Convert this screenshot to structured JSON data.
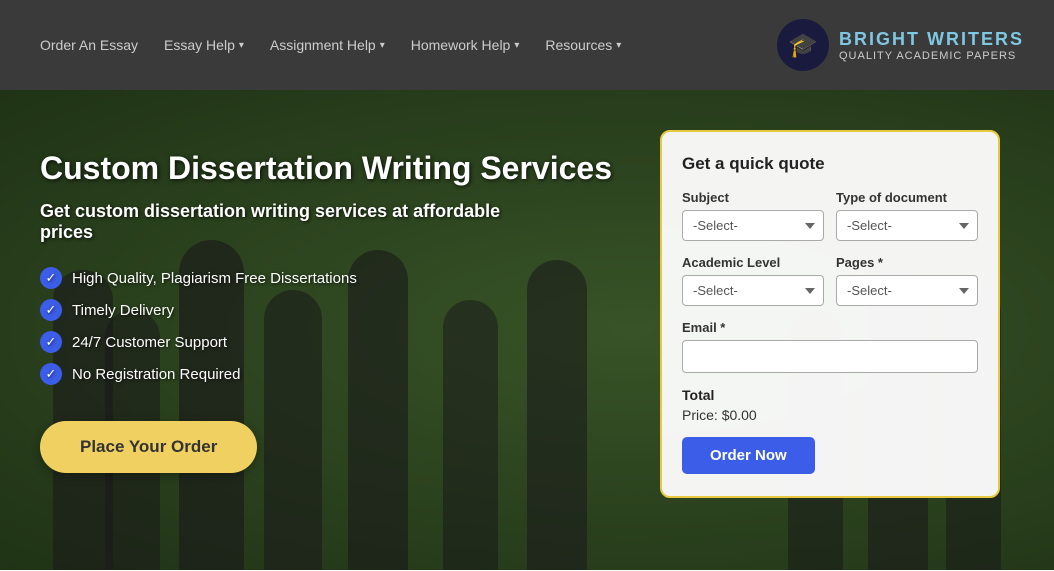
{
  "nav": {
    "links": [
      {
        "label": "Order An Essay",
        "hasDropdown": false
      },
      {
        "label": "Essay Help",
        "hasDropdown": true
      },
      {
        "label": "Assignment Help",
        "hasDropdown": true
      },
      {
        "label": "Homework Help",
        "hasDropdown": true
      },
      {
        "label": "Resources",
        "hasDropdown": true
      }
    ]
  },
  "logo": {
    "icon": "🎓",
    "title": "BRIGHT WRITERS",
    "subtitle": "QUALITY ACADEMIC PAPERS"
  },
  "hero": {
    "title": "Custom Dissertation Writing Services",
    "subtitle": "Get custom dissertation writing services at affordable prices",
    "features": [
      "High Quality, Plagiarism Free Dissertations",
      "Timely Delivery",
      "24/7 Customer Support",
      "No Registration Required"
    ],
    "cta_label": "Place Your Order"
  },
  "quote_form": {
    "title": "Get a quick quote",
    "subject_label": "Subject",
    "subject_placeholder": "-Select-",
    "doc_type_label": "Type of document",
    "doc_type_placeholder": "-Select-",
    "academic_level_label": "Academic Level",
    "academic_level_placeholder": "-Select-",
    "pages_label": "Pages *",
    "pages_placeholder": "-Select-",
    "email_label": "Email *",
    "email_placeholder": "",
    "total_label": "Total",
    "price_label": "Price:",
    "price_value": "$0.00",
    "order_button_label": "Order Now"
  }
}
